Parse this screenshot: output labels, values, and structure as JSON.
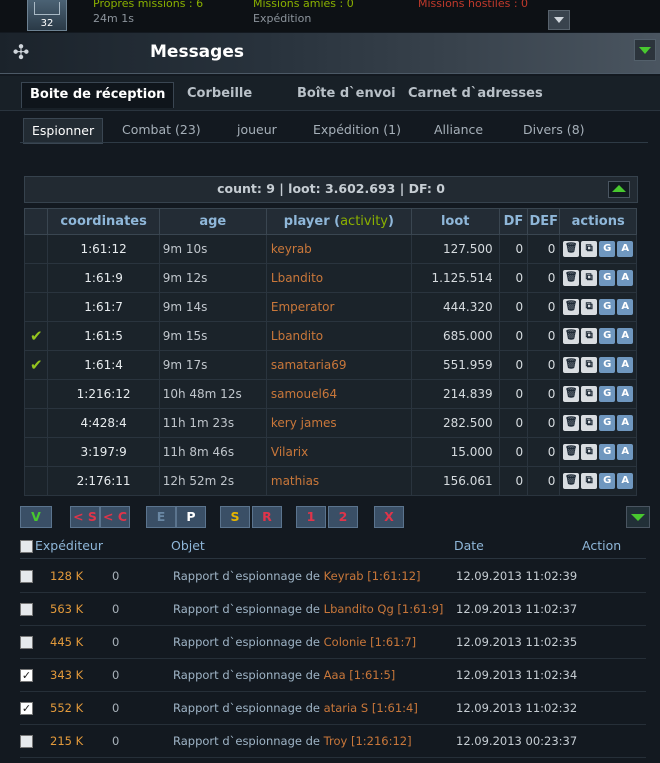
{
  "topbar": {
    "unread_count": "32",
    "own_missions": "Propres missions : 6",
    "friendly_missions": "Missions amies : 0",
    "hostile_missions": "Missions hostiles : 0",
    "timer": "24m 1s",
    "mission_type": "Expédition"
  },
  "header": {
    "title": "Messages"
  },
  "folder_tabs": [
    "Boite de réception",
    "Corbeille",
    "Boîte d`envoi",
    "Carnet d`adresses"
  ],
  "category_tabs": [
    "Espionner",
    "Combat (23)",
    "joueur",
    "Expédition (1)",
    "Alliance",
    "Divers (8)"
  ],
  "summary": "count: 9 | loot: 3.602.693 | DF: 0",
  "spy_table": {
    "headers": {
      "coordinates": "coordinates",
      "age": "age",
      "player": "player (",
      "activity": "activity",
      "player_close": ")",
      "loot": "loot",
      "df": "DF",
      "def": "DEF",
      "actions": "actions"
    },
    "action_icons": [
      "trash-icon",
      "open-icon",
      "G",
      "A"
    ],
    "check_mark": "✔",
    "rows": [
      {
        "checked": false,
        "coord": "1:61:12",
        "age": "9m 10s",
        "player": "keyrab",
        "loot": "127.500",
        "df": "0",
        "def": "0"
      },
      {
        "checked": false,
        "coord": "1:61:9",
        "age": "9m 12s",
        "player": "Lbandito",
        "loot": "1.125.514",
        "df": "0",
        "def": "0"
      },
      {
        "checked": false,
        "coord": "1:61:7",
        "age": "9m 14s",
        "player": "Emperator",
        "loot": "444.320",
        "df": "0",
        "def": "0"
      },
      {
        "checked": true,
        "coord": "1:61:5",
        "age": "9m 15s",
        "player": "Lbandito",
        "loot": "685.000",
        "df": "0",
        "def": "0"
      },
      {
        "checked": true,
        "coord": "1:61:4",
        "age": "9m 17s",
        "player": "samataria69",
        "loot": "551.959",
        "df": "0",
        "def": "0"
      },
      {
        "checked": false,
        "coord": "1:216:12",
        "age": "10h 48m 12s",
        "player": "samouel64",
        "loot": "214.839",
        "df": "0",
        "def": "0"
      },
      {
        "checked": false,
        "coord": "4:428:4",
        "age": "11h 1m 23s",
        "player": "kery james",
        "loot": "282.500",
        "df": "0",
        "def": "0"
      },
      {
        "checked": false,
        "coord": "3:197:9",
        "age": "11h 8m 46s",
        "player": "Vilarix",
        "loot": "15.000",
        "df": "0",
        "def": "0"
      },
      {
        "checked": false,
        "coord": "2:176:11",
        "age": "12h 52m 2s",
        "player": "mathias",
        "loot": "156.061",
        "df": "0",
        "def": "0"
      }
    ]
  },
  "filter_buttons": [
    "V",
    "< S",
    "< C",
    "E",
    "P",
    "S",
    "R",
    "1",
    "2",
    "X"
  ],
  "list_headers": {
    "sender": "Expéditeur",
    "subject": "Objet",
    "date": "Date",
    "action": "Action"
  },
  "messages": [
    {
      "checked": false,
      "size": "128 K",
      "zero": "0",
      "prefix": "Rapport d`espionnage de ",
      "target": "Keyrab [1:61:12]",
      "date": "12.09.2013 11:02:39"
    },
    {
      "checked": false,
      "size": "563 K",
      "zero": "0",
      "prefix": "Rapport d`espionnage de ",
      "target": "Lbandito Qg [1:61:9]",
      "date": "12.09.2013 11:02:37"
    },
    {
      "checked": false,
      "size": "445 K",
      "zero": "0",
      "prefix": "Rapport d`espionnage de ",
      "target": "Colonie [1:61:7]",
      "date": "12.09.2013 11:02:35"
    },
    {
      "checked": true,
      "size": "343 K",
      "zero": "0",
      "prefix": "Rapport d`espionnage de ",
      "target": "Aaa [1:61:5]",
      "date": "12.09.2013 11:02:34"
    },
    {
      "checked": true,
      "size": "552 K",
      "zero": "0",
      "prefix": "Rapport d`espionnage de ",
      "target": "ataria S [1:61:4]",
      "date": "12.09.2013 11:02:32"
    },
    {
      "checked": false,
      "size": "215 K",
      "zero": "0",
      "prefix": "Rapport d`espionnage de ",
      "target": "Troy [1:216:12]",
      "date": "12.09.2013 00:23:37"
    }
  ]
}
